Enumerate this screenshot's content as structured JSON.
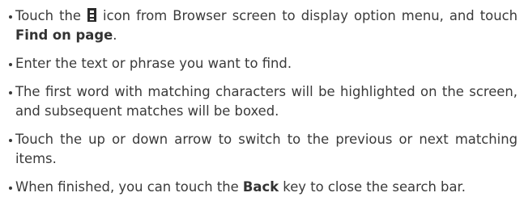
{
  "instructions": [
    {
      "parts": [
        {
          "type": "text",
          "text": "Touch the "
        },
        {
          "type": "icon",
          "icon": "menu-icon"
        },
        {
          "type": "text",
          "text": " icon from Browser screen to display option menu, and touch "
        },
        {
          "type": "bold",
          "text": "Find on page"
        },
        {
          "type": "text",
          "text": "."
        }
      ]
    },
    {
      "parts": [
        {
          "type": "text",
          "text": "Enter the text or phrase you want to find."
        }
      ]
    },
    {
      "parts": [
        {
          "type": "text",
          "text": "The first word with matching characters will be highlighted on the screen, and subsequent matches will be boxed."
        }
      ]
    },
    {
      "parts": [
        {
          "type": "text",
          "text": "Touch the up or down arrow to switch to the previous or next matching items."
        }
      ]
    },
    {
      "parts": [
        {
          "type": "text",
          "text": "When finished, you can touch the "
        },
        {
          "type": "bold",
          "text": "Back"
        },
        {
          "type": "text",
          "text": " key to close the search bar."
        }
      ]
    }
  ]
}
